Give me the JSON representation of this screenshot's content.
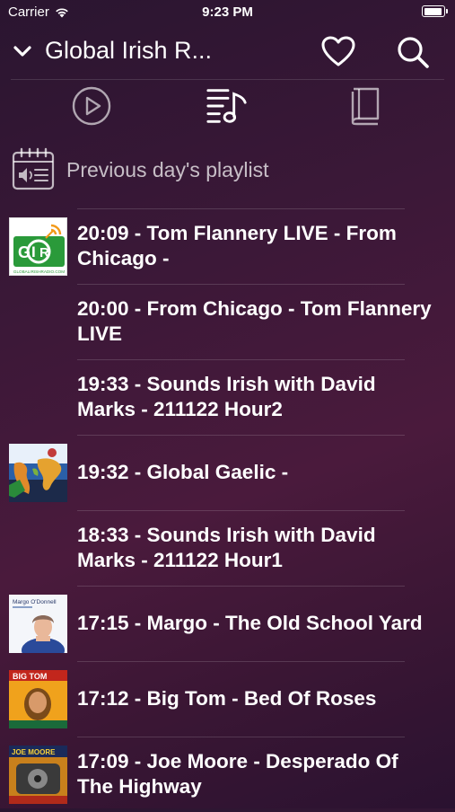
{
  "status_bar": {
    "carrier": "Carrier",
    "time": "9:23 PM"
  },
  "header": {
    "title": "Global Irish R..."
  },
  "tabs": [
    {
      "name": "play-tab",
      "icon": "play-circle-icon"
    },
    {
      "name": "playlist-tab",
      "icon": "music-list-icon",
      "active": true
    },
    {
      "name": "book-tab",
      "icon": "book-icon"
    }
  ],
  "previous_day": {
    "label": "Previous day's playlist"
  },
  "playlist": [
    {
      "text": "20:09 - Tom Flannery LIVE - From Chicago -",
      "art": "globalirishradio-logo"
    },
    {
      "text": "20:00 - From Chicago - Tom Flannery LIVE",
      "art": null
    },
    {
      "text": "19:33 - Sounds Irish with David Marks - 211122 Hour2",
      "art": null
    },
    {
      "text": "19:32 - Global Gaelic -",
      "art": "world-map-art"
    },
    {
      "text": "18:33 - Sounds Irish with David Marks - 211122 Hour1",
      "art": null
    },
    {
      "text": "17:15 - Margo - The Old School Yard",
      "art": "margo-album-art"
    },
    {
      "text": "17:12 - Big Tom - Bed Of Roses",
      "art": "big-tom-album-art"
    },
    {
      "text": "17:09 - Joe Moore - Desperado Of The Highway",
      "art": "joe-moore-album-art"
    }
  ],
  "art_text": {
    "gir_logo": "GLOBALIRISHRADIO.COM",
    "margo_name": "Margo O'Donnell",
    "big_tom": "BIG TOM",
    "joe_moore": "JOE MOORE"
  },
  "colors": {
    "background": "#3c1838",
    "text": "#ffffff",
    "gir_green": "#2a9a3a"
  }
}
